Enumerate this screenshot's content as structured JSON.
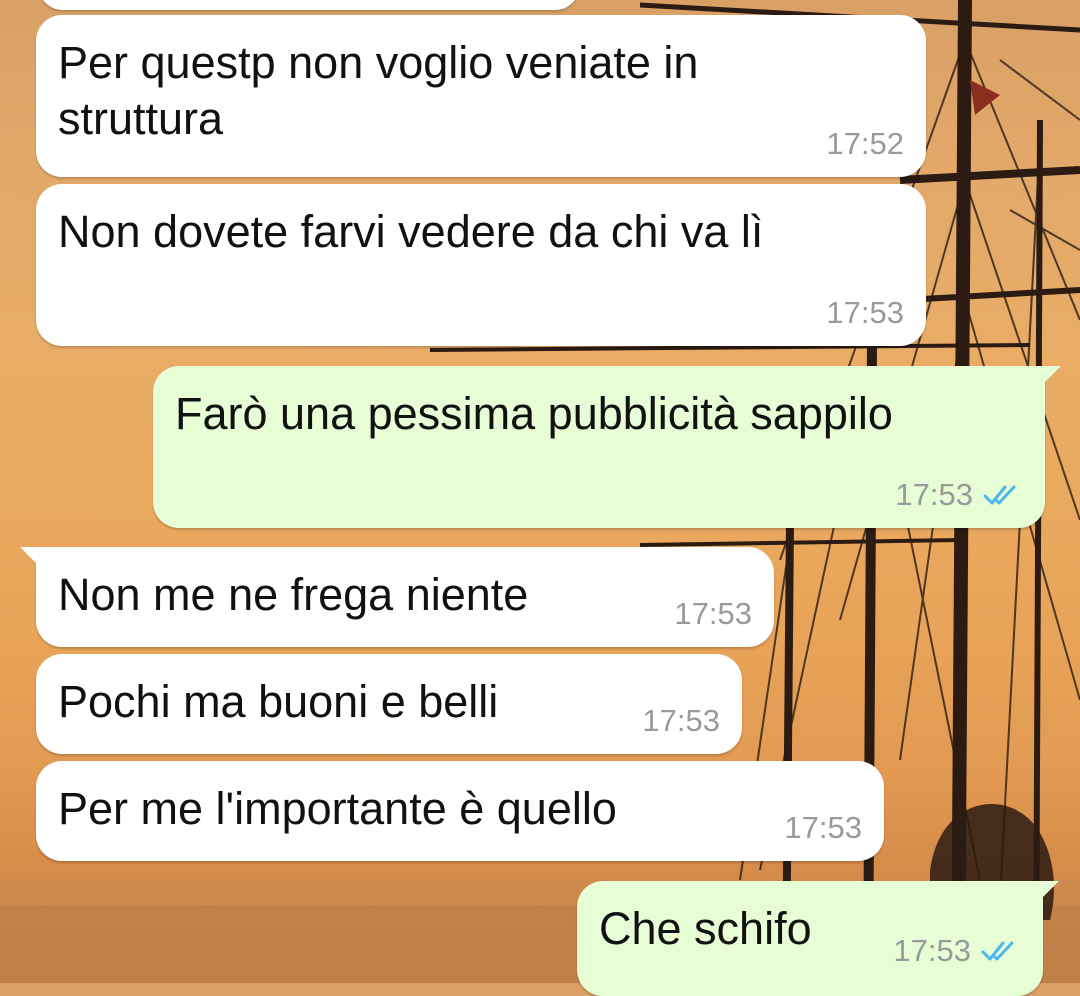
{
  "colors": {
    "incoming_bubble": "#ffffff",
    "outgoing_bubble": "#e6fdd6",
    "read_check": "#4fb6ec",
    "timestamp": "#9a9a9a"
  },
  "wallpaper": {
    "icon": "sailing-ship-sunset-wallpaper"
  },
  "messages": [
    {
      "direction": "incoming",
      "text": "Per questp non voglio veniate in\nstruttura",
      "time": "17:52"
    },
    {
      "direction": "incoming",
      "text": "Non dovete farvi vedere da chi va lì",
      "time": "17:53"
    },
    {
      "direction": "outgoing",
      "text": "Farò una pessima pubblicità sappilo",
      "time": "17:53",
      "status_icon": "double-check-read-icon"
    },
    {
      "direction": "incoming",
      "text": "Non me ne frega niente",
      "time": "17:53"
    },
    {
      "direction": "incoming",
      "text": "Pochi ma buoni e belli",
      "time": "17:53"
    },
    {
      "direction": "incoming",
      "text": "Per me l'importante è quello",
      "time": "17:53"
    },
    {
      "direction": "outgoing",
      "text": "Che schifo",
      "time": "17:53",
      "status_icon": "double-check-read-icon"
    }
  ]
}
